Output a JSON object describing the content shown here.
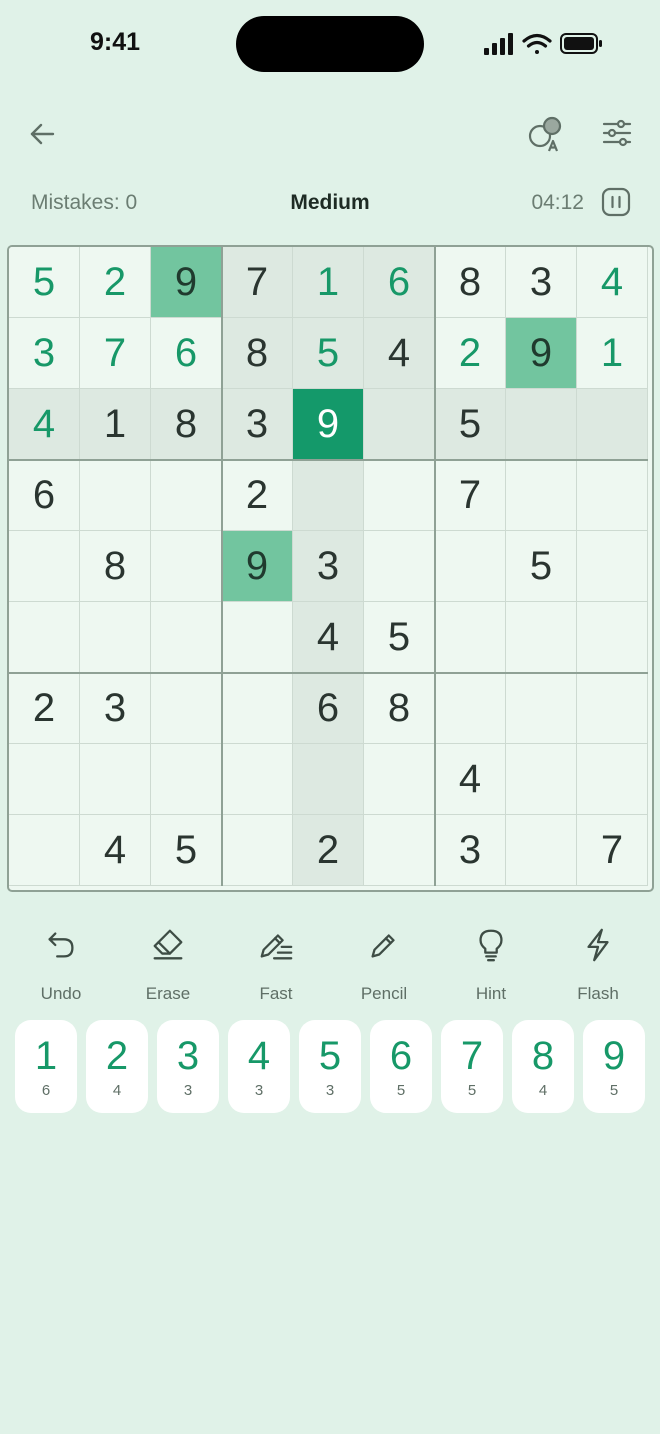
{
  "status_bar": {
    "time": "9:41"
  },
  "header": {
    "icons": {
      "back": "arrow-left-icon",
      "theme": "shapes-letter-icon",
      "settings": "sliders-icon"
    }
  },
  "info": {
    "mistakes": "Mistakes: 0",
    "difficulty": "Medium",
    "timer": "04:12"
  },
  "board": {
    "rows": [
      [
        "5",
        "2",
        "9",
        "7",
        "1",
        "6",
        "8",
        "3",
        "4"
      ],
      [
        "3",
        "7",
        "6",
        "8",
        "5",
        "4",
        "2",
        "9",
        "1"
      ],
      [
        "4",
        "1",
        "8",
        "3",
        "9",
        "",
        "5",
        "",
        ""
      ],
      [
        "6",
        "",
        "",
        "2",
        "",
        "",
        "7",
        "",
        ""
      ],
      [
        "",
        "8",
        "",
        "9",
        "3",
        "",
        "",
        "5",
        ""
      ],
      [
        "",
        "",
        "",
        "",
        "4",
        "5",
        "",
        "",
        ""
      ],
      [
        "2",
        "3",
        "",
        "",
        "6",
        "8",
        "",
        "",
        ""
      ],
      [
        "",
        "",
        "",
        "",
        "",
        "",
        "4",
        "",
        ""
      ],
      [
        "",
        "4",
        "5",
        "",
        "2",
        "",
        "3",
        "",
        "7"
      ]
    ],
    "user_entries": [
      [
        0,
        0
      ],
      [
        0,
        1
      ],
      [
        0,
        4
      ],
      [
        0,
        5
      ],
      [
        0,
        8
      ],
      [
        1,
        0
      ],
      [
        1,
        1
      ],
      [
        1,
        2
      ],
      [
        1,
        4
      ],
      [
        1,
        6
      ],
      [
        1,
        7
      ],
      [
        1,
        8
      ],
      [
        2,
        0
      ]
    ],
    "selected": [
      2,
      4
    ],
    "selected_color": "#14996a",
    "highlight_same_color": "#72c59f",
    "highlight_related_color": "#dde9e1",
    "user_digit_color": "#179868"
  },
  "tools": [
    {
      "label": "Undo",
      "icon": "undo-icon"
    },
    {
      "label": "Erase",
      "icon": "eraser-icon"
    },
    {
      "label": "Fast",
      "icon": "fast-pencil-icon"
    },
    {
      "label": "Pencil",
      "icon": "pencil-icon"
    },
    {
      "label": "Hint",
      "icon": "lightbulb-icon"
    },
    {
      "label": "Flash",
      "icon": "lightning-icon"
    }
  ],
  "number_pad": [
    {
      "digit": "1",
      "count": "6"
    },
    {
      "digit": "2",
      "count": "4"
    },
    {
      "digit": "3",
      "count": "3"
    },
    {
      "digit": "4",
      "count": "3"
    },
    {
      "digit": "5",
      "count": "3"
    },
    {
      "digit": "6",
      "count": "5"
    },
    {
      "digit": "7",
      "count": "5"
    },
    {
      "digit": "8",
      "count": "4"
    },
    {
      "digit": "9",
      "count": "5"
    }
  ]
}
